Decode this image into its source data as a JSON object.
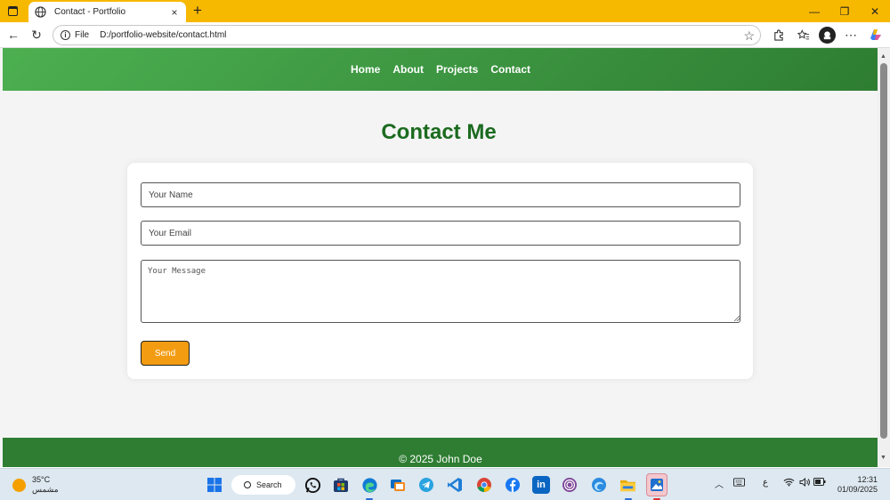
{
  "browser": {
    "tab_title": "Contact - Portfolio",
    "tab_close": "×",
    "new_tab": "+",
    "minimize": "—",
    "maximize": "❐",
    "close": "✕",
    "back": "←",
    "reload": "↻",
    "address_scheme_label": "File",
    "address_url": "D:/portfolio-website/contact.html",
    "favorite": "☆"
  },
  "site": {
    "nav": [
      "Home",
      "About",
      "Projects",
      "Contact"
    ],
    "title": "Contact Me",
    "form": {
      "name_placeholder": "Your Name",
      "email_placeholder": "Your Email",
      "message_placeholder": "Your Message",
      "send_label": "Send"
    },
    "footer": "© 2025 John Doe"
  },
  "taskbar": {
    "temperature": "35°C",
    "weather_desc": "مشمس",
    "search_label": "Search",
    "input_lang": "ع",
    "time": "12:31",
    "date": "01/09/2025",
    "apps": [
      "start-icon",
      "whatsapp-icon",
      "store-icon",
      "edge-icon",
      "remote-icon",
      "telegram-icon",
      "vscode-icon",
      "chrome-icon",
      "facebook-icon",
      "linkedin-icon",
      "tor-icon",
      "browser-icon",
      "file-explorer-icon",
      "photos-icon"
    ]
  },
  "colors": {
    "titlebar": "#f7b800",
    "header_start": "#4caf50",
    "header_end": "#2e7d32",
    "title": "#1b6b1f",
    "send_button": "#f39c12",
    "footer": "#2e7d32"
  }
}
